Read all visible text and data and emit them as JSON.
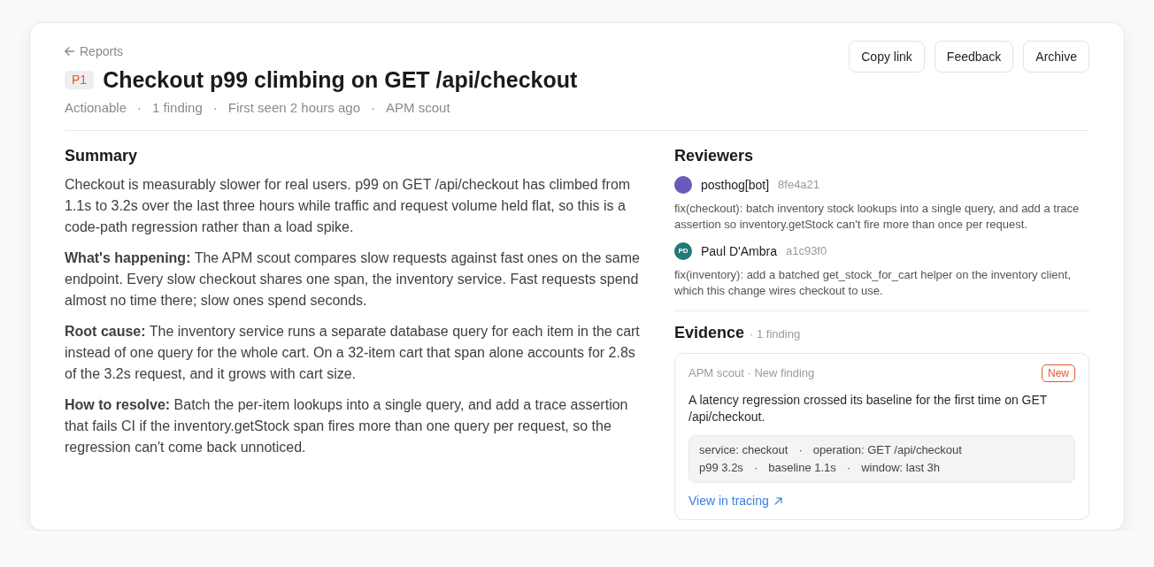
{
  "breadcrumb": {
    "label": "Reports"
  },
  "header": {
    "priority": "P1",
    "title": "Checkout p99 climbing on GET /api/checkout",
    "meta_separator": "·",
    "meta": [
      "Actionable",
      "1 finding",
      "First seen 2 hours ago",
      "APM scout"
    ]
  },
  "actions": [
    "Copy link",
    "Feedback",
    "Archive"
  ],
  "summary": {
    "title": "Summary",
    "paragraphs": [
      "Checkout is measurably slower for real users. p99 on GET /api/checkout has climbed from 1.1s to 3.2s over the last three hours while traffic and request volume held flat, so this is a code-path regression rather than a load spike.",
      "**What's happening:** The APM scout compares slow requests against fast ones on the same endpoint. Every slow checkout shares one span, the inventory service. Fast requests spend almost no time there; slow ones spend seconds.",
      "**Root cause:** The inventory service runs a separate database query for each item in the cart instead of one query for the whole cart. On a 32-item cart that span alone accounts for 2.8s of the 3.2s request, and it grows with cart size.",
      "**How to resolve:** Batch the per-item lookups into a single query, and add a trace assertion that fails CI if the inventory.getStock span fires more than one query per request, so the regression can't come back unnoticed."
    ]
  },
  "reviewers": {
    "title": "Reviewers",
    "items": [
      {
        "name": "posthog[bot]",
        "commit": "8fe4a21",
        "color": "#6a5ab8",
        "message": "fix(checkout): batch inventory stock lookups into a single query, and add a trace assertion so inventory.getStock can't fire more than once per request."
      },
      {
        "name": "Paul D'Ambra",
        "initials": "PD",
        "commit": "a1c93f0",
        "color": "#23787a",
        "message": "fix(inventory): add a batched get_stock_for_cart helper on the inventory client, which this change wires checkout to use."
      }
    ]
  },
  "evidence": {
    "title": "Evidence",
    "count": "· 1 finding",
    "findings": [
      {
        "source": "APM scout · New finding",
        "badge": "New",
        "description": "A latency regression crossed its baseline for the first time on GET /api/checkout.",
        "separator": "·",
        "details": [
          [
            "service: checkout",
            "operation: GET /api/checkout"
          ],
          [
            "p99 3.2s",
            "baseline 1.1s",
            "window: last 3h"
          ]
        ],
        "link": "View in tracing"
      }
    ]
  }
}
